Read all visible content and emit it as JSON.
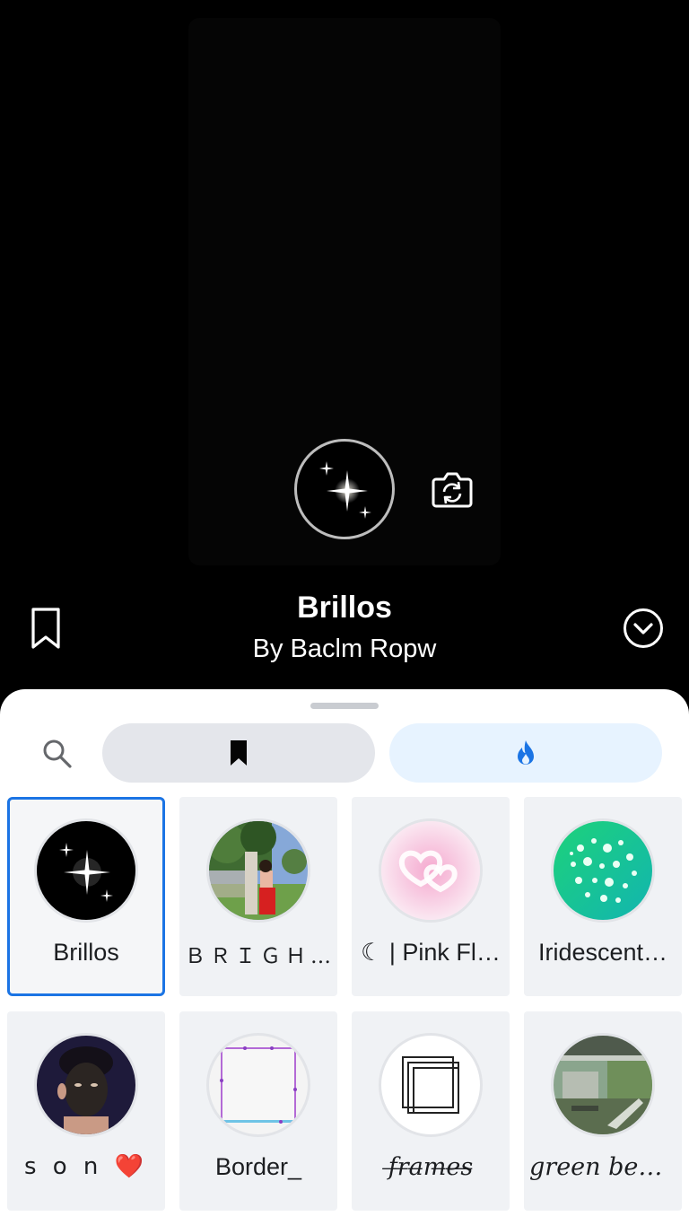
{
  "effect": {
    "title": "Brillos",
    "author": "By Baclm Ropw"
  },
  "icons": {
    "capture": "sparkle-icon",
    "flip_camera": "flip-camera-icon",
    "save": "bookmark-outline-icon",
    "collapse": "chevron-down-circle-icon",
    "search": "search-icon",
    "saved_tab": "bookmark-filled-icon",
    "trending_tab": "flame-icon"
  },
  "colors": {
    "accent": "#1b74e4",
    "sheet_background": "#ffffff",
    "tile_background": "#f0f2f5"
  },
  "effects_grid": [
    {
      "label": "Brillos",
      "selected": true,
      "thumb": "sparkles-black"
    },
    {
      "label": "ＢＲＩＧＨＴ…",
      "selected": false,
      "thumb": "photo-girl-gate"
    },
    {
      "label": "☾ | Pink Fl…",
      "selected": false,
      "thumb": "pink-hearts"
    },
    {
      "label": "Iridescent…",
      "selected": false,
      "thumb": "green-bubbles"
    },
    {
      "label": "s o n ❤️",
      "selected": false,
      "thumb": "photo-face-mask"
    },
    {
      "label": "Border_",
      "selected": false,
      "thumb": "white-border-frame"
    },
    {
      "label": "f̶r̶a̶m̶e̶s̶",
      "selected": false,
      "thumb": "stacked-squares"
    },
    {
      "label": "green beq…",
      "selected": false,
      "thumb": "photo-green-building"
    }
  ]
}
